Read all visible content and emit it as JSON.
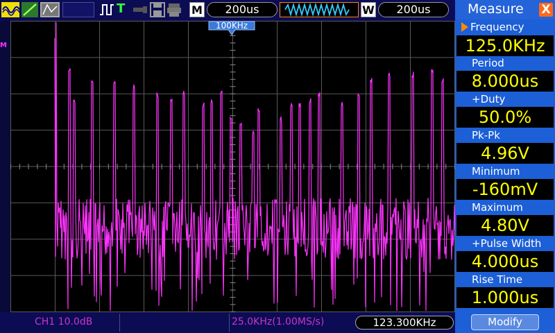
{
  "toolbar": {
    "horizontal_button": "M",
    "horizontal_time": "200us",
    "window_button": "W",
    "window_time": "200us",
    "trigger_label": "T"
  },
  "fft": {
    "center_marker": "100KHz",
    "left_marker": "M"
  },
  "bottom": {
    "channel_scale": "CH1 10.0dB",
    "sample_info": "25.0KHz(1.00MS/s)",
    "cursor_freq": "123.300KHz"
  },
  "panel": {
    "title": "Measure",
    "close": "X",
    "measurements": [
      {
        "label": "Frequency",
        "value": "125.0KHz"
      },
      {
        "label": "Period",
        "value": "8.000us"
      },
      {
        "label": "+Duty",
        "value": "50.0%"
      },
      {
        "label": "Pk-Pk",
        "value": "4.96V"
      },
      {
        "label": "Minimum",
        "value": "-160mV"
      },
      {
        "label": "Maximum",
        "value": "4.80V"
      },
      {
        "label": "+Pulse Width",
        "value": "4.000us"
      },
      {
        "label": "Rise Time",
        "value": "1.000us"
      }
    ],
    "modify": "Modify"
  },
  "colors": {
    "trace": "#ff33ff",
    "panel_bg": "#1c5fd6",
    "value_text": "#ffff00",
    "close_bg": "#ff6a1a"
  }
}
